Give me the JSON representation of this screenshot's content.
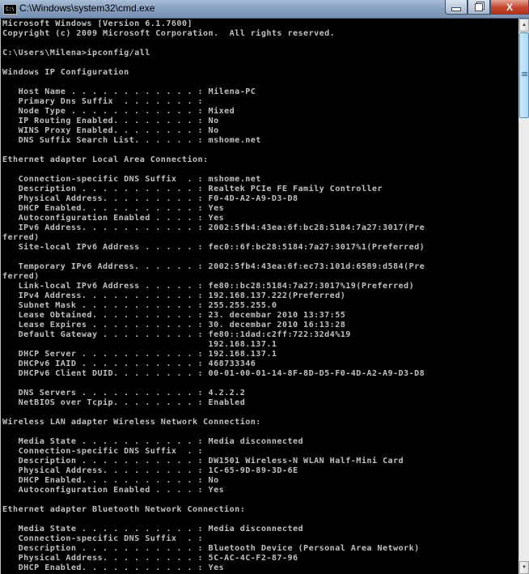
{
  "window": {
    "title": "C:\\Windows\\system32\\cmd.exe",
    "app_icon_text": "C:\\",
    "buttons": {
      "minimize": "minimize",
      "maximize": "restore",
      "close": "X"
    }
  },
  "console": {
    "lines": [
      "Microsoft Windows [Version 6.1.7600]",
      "Copyright (c) 2009 Microsoft Corporation.  All rights reserved.",
      "",
      "C:\\Users\\Milena>ipconfig/all",
      "",
      "Windows IP Configuration",
      "",
      "   Host Name . . . . . . . . . . . . : Milena-PC",
      "   Primary Dns Suffix  . . . . . . . :",
      "   Node Type . . . . . . . . . . . . : Mixed",
      "   IP Routing Enabled. . . . . . . . : No",
      "   WINS Proxy Enabled. . . . . . . . : No",
      "   DNS Suffix Search List. . . . . . : mshome.net",
      "",
      "Ethernet adapter Local Area Connection:",
      "",
      "   Connection-specific DNS Suffix  . : mshome.net",
      "   Description . . . . . . . . . . . : Realtek PCIe FE Family Controller",
      "   Physical Address. . . . . . . . . : F0-4D-A2-A9-D3-D8",
      "   DHCP Enabled. . . . . . . . . . . : Yes",
      "   Autoconfiguration Enabled . . . . : Yes",
      "   IPv6 Address. . . . . . . . . . . : 2002:5fb4:43ea:6f:bc28:5184:7a27:3017(Pre",
      "ferred)",
      "   Site-local IPv6 Address . . . . . : fec0::6f:bc28:5184:7a27:3017%1(Preferred)",
      "",
      "   Temporary IPv6 Address. . . . . . : 2002:5fb4:43ea:6f:ec73:101d:6589:d584(Pre",
      "ferred)",
      "   Link-local IPv6 Address . . . . . : fe80::bc28:5184:7a27:3017%19(Preferred)",
      "   IPv4 Address. . . . . . . . . . . : 192.168.137.222(Preferred)",
      "   Subnet Mask . . . . . . . . . . . : 255.255.255.0",
      "   Lease Obtained. . . . . . . . . . : 23. decembar 2010 13:37:55",
      "   Lease Expires . . . . . . . . . . : 30. decembar 2010 16:13:28",
      "   Default Gateway . . . . . . . . . : fe80::1dad:c2ff:722:32d4%19",
      "                                       192.168.137.1",
      "   DHCP Server . . . . . . . . . . . : 192.168.137.1",
      "   DHCPv6 IAID . . . . . . . . . . . : 468733346",
      "   DHCPv6 Client DUID. . . . . . . . : 00-01-00-01-14-8F-8D-D5-F0-4D-A2-A9-D3-D8",
      "",
      "   DNS Servers . . . . . . . . . . . : 4.2.2.2",
      "   NetBIOS over Tcpip. . . . . . . . : Enabled",
      "",
      "Wireless LAN adapter Wireless Network Connection:",
      "",
      "   Media State . . . . . . . . . . . : Media disconnected",
      "   Connection-specific DNS Suffix  . :",
      "   Description . . . . . . . . . . . : DW1501 Wireless-N WLAN Half-Mini Card",
      "   Physical Address. . . . . . . . . : 1C-65-9D-89-3D-6E",
      "   DHCP Enabled. . . . . . . . . . . : No",
      "   Autoconfiguration Enabled . . . . : Yes",
      "",
      "Ethernet adapter Bluetooth Network Connection:",
      "",
      "   Media State . . . . . . . . . . . : Media disconnected",
      "   Connection-specific DNS Suffix  . :",
      "   Description . . . . . . . . . . . : Bluetooth Device (Personal Area Network)",
      "   Physical Address. . . . . . . . . : 5C-AC-4C-F2-87-96",
      "   DHCP Enabled. . . . . . . . . . . : Yes"
    ]
  },
  "scrollbar": {
    "up_arrow": "▲",
    "down_arrow": "▼"
  },
  "colors": {
    "console_bg": "#000000",
    "console_text": "#c0c0c0"
  }
}
